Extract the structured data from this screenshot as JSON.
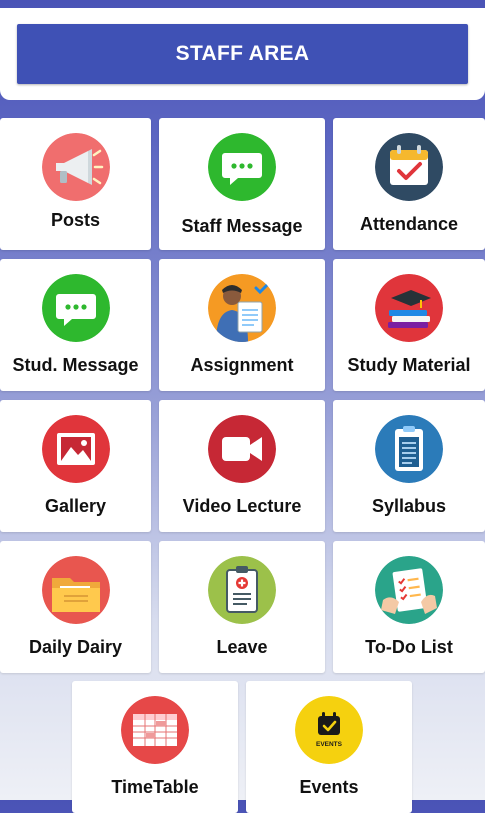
{
  "header": {
    "title": "STAFF AREA"
  },
  "tiles": [
    {
      "label": "Posts",
      "icon": "megaphone-icon"
    },
    {
      "label": "Staff Message",
      "icon": "chat-bubble-icon"
    },
    {
      "label": "Attendance",
      "icon": "calendar-check-icon"
    },
    {
      "label": "Stud. Message",
      "icon": "chat-bubble-icon"
    },
    {
      "label": "Assignment",
      "icon": "student-document-icon"
    },
    {
      "label": "Study Material",
      "icon": "books-icon"
    },
    {
      "label": "Gallery",
      "icon": "image-icon"
    },
    {
      "label": "Video Lecture",
      "icon": "video-camera-icon"
    },
    {
      "label": "Syllabus",
      "icon": "clipboard-icon"
    },
    {
      "label": "Daily Dairy",
      "icon": "folder-icon"
    },
    {
      "label": "Leave",
      "icon": "medical-clipboard-icon"
    },
    {
      "label": "To-Do List",
      "icon": "checklist-icon"
    },
    {
      "label": "TimeTable",
      "icon": "timetable-icon"
    },
    {
      "label": "Events",
      "icon": "event-calendar-icon"
    }
  ],
  "icon_texts": {
    "events_badge": "EVENTS"
  },
  "colors": {
    "primary": "#3f51b5",
    "posts": "#f06e6e",
    "message": "#2eb82e",
    "attendance": "#2f4a63",
    "study_material": "#e0353b",
    "gallery": "#e0353b",
    "video": "#c62835",
    "syllabus": "#2b7bb9",
    "daily_dairy": "#e8564f",
    "leave": "#9cc14a",
    "todo": "#2aa48a",
    "timetable": "#e64848",
    "events": "#f5d10f"
  }
}
